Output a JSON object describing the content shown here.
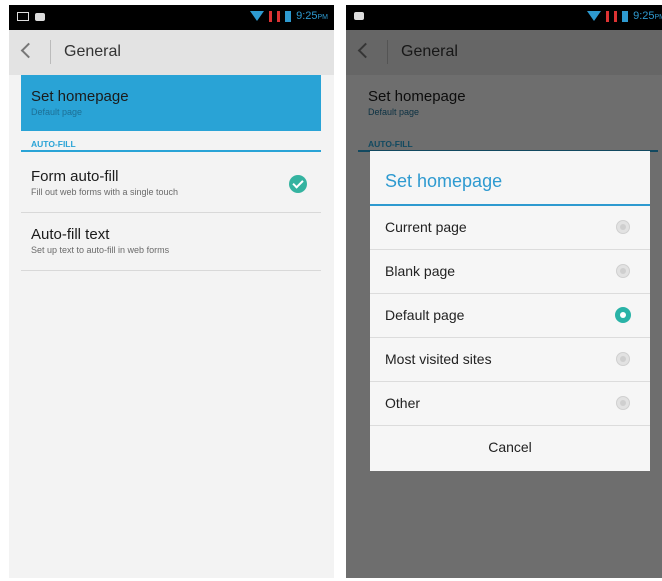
{
  "status_bar": {
    "time": "9:25",
    "time_suffix": "PM"
  },
  "action_bar": {
    "title": "General"
  },
  "preferences": {
    "set_homepage": {
      "title": "Set homepage",
      "summary": "Default page"
    },
    "section_autofill": "AUTO-FILL",
    "form_autofill": {
      "title": "Form auto-fill",
      "summary": "Fill out web forms with a single touch",
      "checked": true
    },
    "autofill_text": {
      "title": "Auto-fill text",
      "summary": "Set up text to auto-fill in web forms"
    }
  },
  "dialog": {
    "title": "Set homepage",
    "options": [
      {
        "label": "Current page",
        "selected": false
      },
      {
        "label": "Blank page",
        "selected": false
      },
      {
        "label": "Default page",
        "selected": true
      },
      {
        "label": "Most visited sites",
        "selected": false
      },
      {
        "label": "Other",
        "selected": false
      }
    ],
    "cancel_label": "Cancel"
  },
  "colors": {
    "accent": "#29a3d6",
    "radio_selected": "#2ab3a7"
  }
}
